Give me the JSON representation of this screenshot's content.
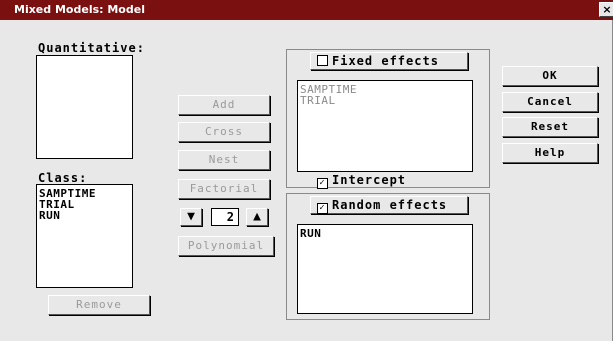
{
  "window": {
    "title": "Mixed Models: Model",
    "close_glyph": "×"
  },
  "quantitative": {
    "label": "Quantitative:",
    "items": []
  },
  "class": {
    "label": "Class:",
    "items": [
      "SAMPTIME",
      "TRIAL",
      "RUN"
    ]
  },
  "remove_label": "Remove",
  "middle_buttons": {
    "add": "Add",
    "cross": "Cross",
    "nest": "Nest",
    "factorial": "Factorial",
    "polynomial": "Polynomial"
  },
  "degree": {
    "value": "2",
    "down_glyph": "▼",
    "up_glyph": "▲"
  },
  "fixed": {
    "label": "Fixed effects",
    "checked": false,
    "items": [
      "SAMPTIME",
      "TRIAL"
    ],
    "intercept_label": "Intercept",
    "intercept_checked": true
  },
  "random": {
    "label": "Random effects",
    "checked": true,
    "items": [
      "RUN"
    ]
  },
  "actions": {
    "ok": "OK",
    "cancel": "Cancel",
    "reset": "Reset",
    "help": "Help"
  },
  "checkmark_glyph": "✓"
}
